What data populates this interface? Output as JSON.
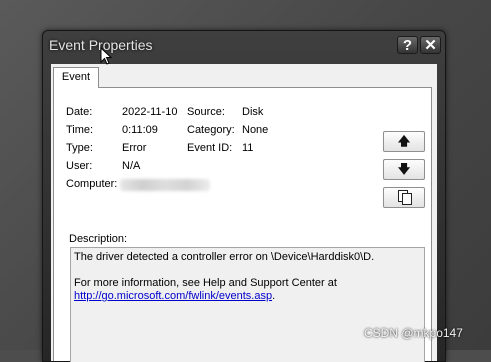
{
  "window": {
    "title": "Event Properties",
    "help_label": "?",
    "close_label": "✕"
  },
  "tabs": [
    {
      "label": "Event"
    }
  ],
  "fields": {
    "date_label": "Date:",
    "date_value": "2022-11-10",
    "source_label": "Source:",
    "source_value": "Disk",
    "time_label": "Time:",
    "time_value": "0:11:09",
    "category_label": "Category:",
    "category_value": "None",
    "type_label": "Type:",
    "type_value": "Error",
    "event_id_label": "Event ID:",
    "event_id_value": "11",
    "user_label": "User:",
    "user_value": "N/A",
    "computer_label": "Computer:"
  },
  "nav": {
    "up_glyph": "🡅",
    "down_glyph": "🡇"
  },
  "description": {
    "label": "Description:",
    "line1": "The driver detected a controller error on \\Device\\Harddisk0\\D.",
    "line2": "For more information, see Help and Support Center at",
    "link": "http://go.microsoft.com/fwlink/events.asp",
    "after_link": "."
  },
  "watermark": "CSDN @mkpo147",
  "icons": [
    "help-icon",
    "close-icon",
    "arrow-up-icon",
    "arrow-down-icon",
    "copy-icon",
    "mouse-cursor-icon"
  ]
}
